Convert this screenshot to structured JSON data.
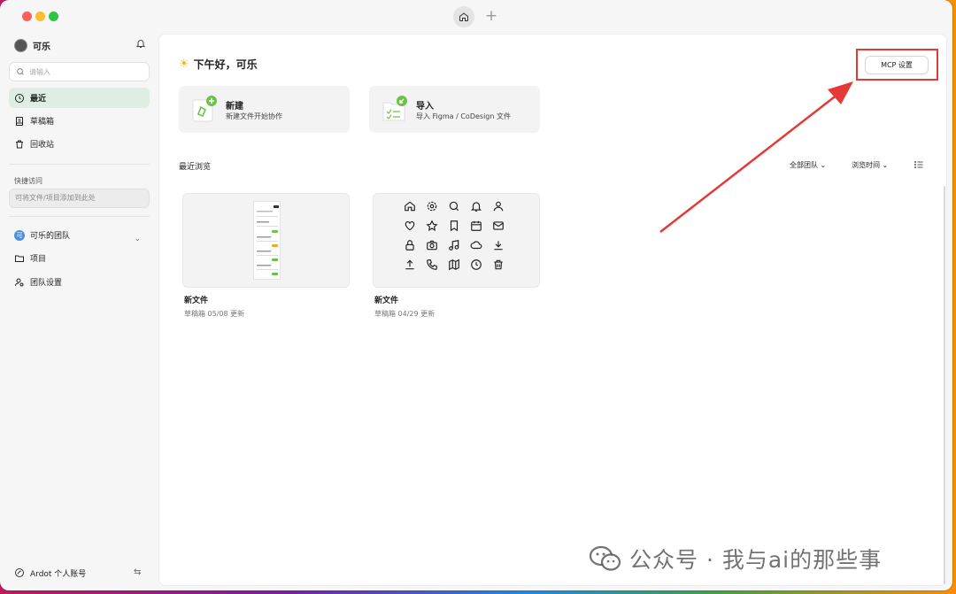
{
  "window": {
    "tab_add": "+"
  },
  "sidebar": {
    "user_name": "可乐",
    "search_placeholder": "请输入",
    "nav": [
      {
        "label": "最近",
        "active": true
      },
      {
        "label": "草稿箱"
      },
      {
        "label": "回收站"
      }
    ],
    "quick_access_title": "快捷访问",
    "quick_access_hint": "可将文件/项目添加到此处",
    "team": {
      "badge": "可",
      "label": "可乐的团队",
      "chevron": "⌄"
    },
    "team_nav": [
      {
        "label": "项目"
      },
      {
        "label": "团队设置"
      }
    ],
    "footer_label": "Ardot 个人账号",
    "switch_symbol": "⇆"
  },
  "main": {
    "greeting_icon": "☀",
    "greeting": "下午好，可乐",
    "mcp_button": "MCP 设置",
    "actions": [
      {
        "title": "新建",
        "desc": "新建文件开始协作"
      },
      {
        "title": "导入",
        "desc": "导入 Figma / CoDesign 文件"
      }
    ],
    "recent_title": "最近浏览",
    "filters": {
      "team": "全部团队 ⌄",
      "sort": "浏览时间 ⌄"
    },
    "files": [
      {
        "name": "新文件",
        "meta": "草稿箱   05/08 更新"
      },
      {
        "name": "新文件",
        "meta": "草稿箱   04/29 更新"
      }
    ]
  },
  "watermark": "公众号 · 我与ai的那些事",
  "colors": {
    "accent_active": "#dfeee4",
    "highlight_red": "#e53935",
    "green": "#6cc24a"
  }
}
